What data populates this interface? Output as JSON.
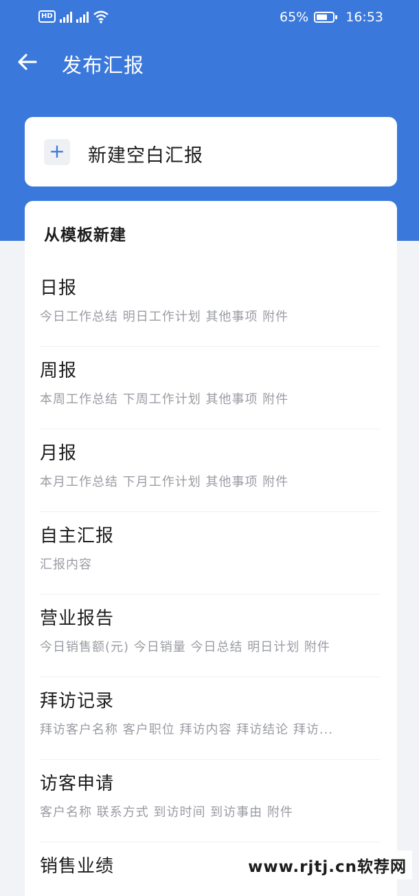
{
  "status_bar": {
    "hd_badge": "HD",
    "battery_text": "65%",
    "battery_level": 0.65,
    "time": "16:53"
  },
  "nav": {
    "title": "发布汇报"
  },
  "blank_report": {
    "label": "新建空白汇报"
  },
  "templates": {
    "heading": "从模板新建",
    "items": [
      {
        "name": "日报",
        "desc": "今日工作总结 明日工作计划 其他事项 附件"
      },
      {
        "name": "周报",
        "desc": "本周工作总结 下周工作计划 其他事项 附件"
      },
      {
        "name": "月报",
        "desc": "本月工作总结 下月工作计划 其他事项 附件"
      },
      {
        "name": "自主汇报",
        "desc": "汇报内容"
      },
      {
        "name": "营业报告",
        "desc": "今日销售额(元) 今日销量 今日总结 明日计划 附件"
      },
      {
        "name": "拜访记录",
        "desc": "拜访客户名称 客户职位 拜访内容 拜访结论 拜访..."
      },
      {
        "name": "访客申请",
        "desc": "客户名称 联系方式 到访时间 到访事由 附件"
      },
      {
        "name": "销售业绩",
        "desc": ""
      }
    ]
  },
  "watermark": "www.rjtj.cn软荐网",
  "colors": {
    "primary": "#3a78db",
    "page_bg": "#f2f3f7",
    "card_bg": "#ffffff",
    "text_main": "#1c1c1c",
    "text_sub": "#9a9ca3"
  }
}
